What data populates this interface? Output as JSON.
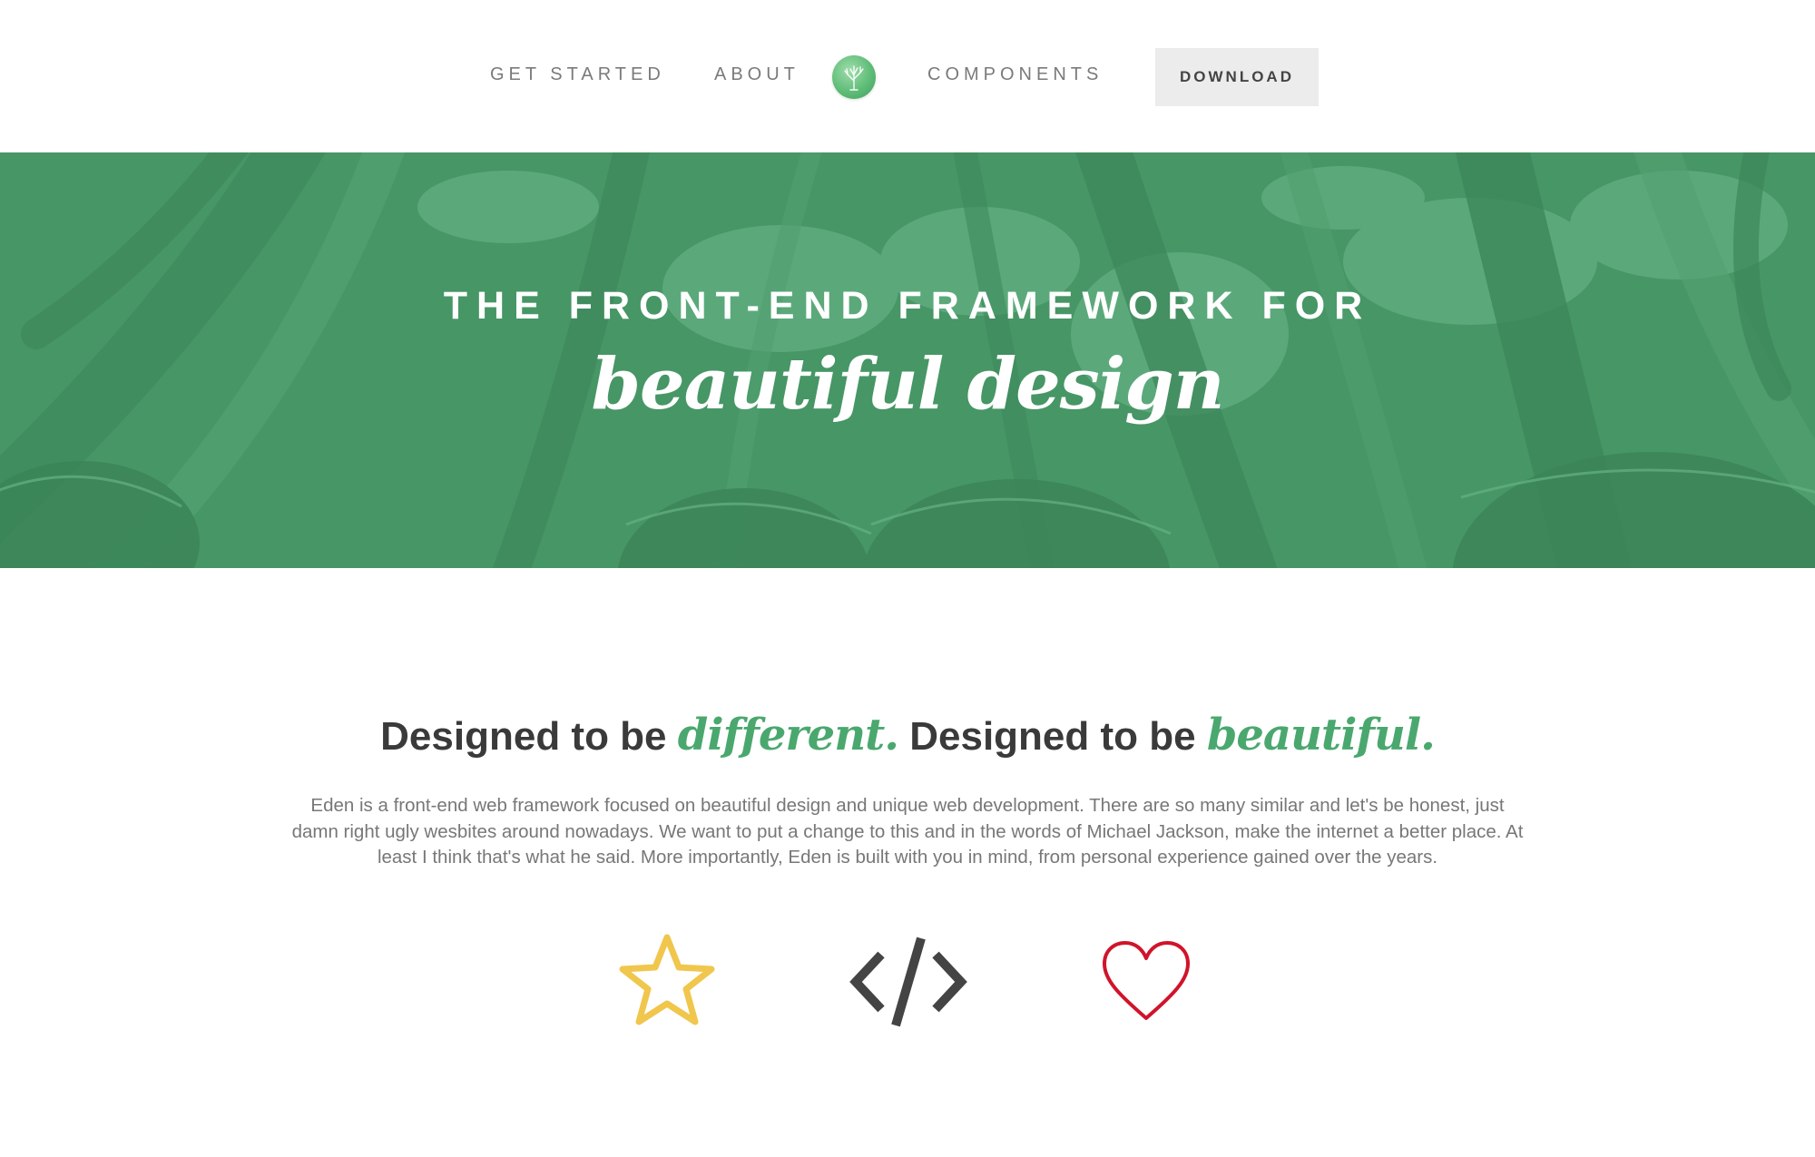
{
  "nav": {
    "links": [
      {
        "label": "GET STARTED"
      },
      {
        "label": "ABOUT"
      },
      {
        "label": "COMPONENTS"
      }
    ],
    "logo_icon": "tree-icon",
    "download_label": "DOWNLOAD"
  },
  "hero": {
    "title": "THE FRONT-END FRAMEWORK FOR",
    "script": "beautiful design"
  },
  "intro": {
    "headline_part1": "Designed to be ",
    "headline_accent1": "different.",
    "headline_part2": " Designed to be ",
    "headline_accent2": "beautiful.",
    "body": "Eden is a front-end web framework focused on beautiful design and unique web development. There are so many similar and let's be honest, just damn right ugly wesbites around nowadays. We want to put a change to this and in the words of Michael Jackson, make the internet a better place. At least I think that's what he said. More importantly, Eden is built with you in mind, from personal experience gained over the years."
  },
  "features": [
    {
      "icon": "star-icon",
      "color": "#f0c64c"
    },
    {
      "icon": "code-icon",
      "color": "#444444"
    },
    {
      "icon": "heart-icon",
      "color": "#d0142a"
    }
  ],
  "colors": {
    "brand_green": "#4aa86e",
    "hero_overlay": "#4a9868",
    "button_bg": "#ececec"
  }
}
